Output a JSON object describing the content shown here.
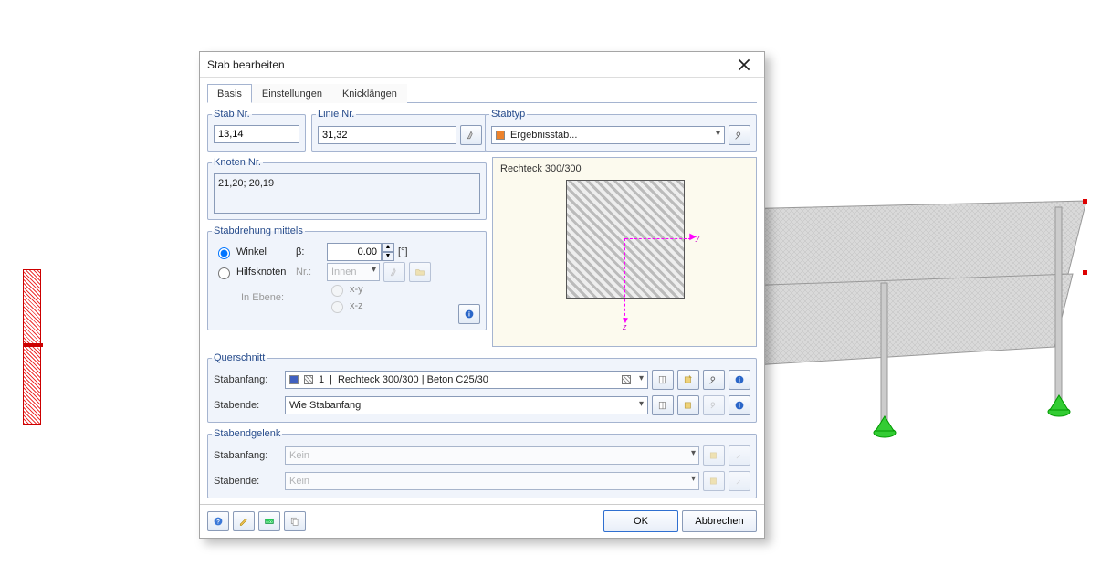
{
  "dialog": {
    "title": "Stab bearbeiten",
    "tabs": [
      "Basis",
      "Einstellungen",
      "Knicklängen"
    ],
    "active_tab": 0
  },
  "stab_nr": {
    "label": "Stab Nr.",
    "value": "13,14"
  },
  "linie_nr": {
    "label": "Linie Nr.",
    "value": "31,32"
  },
  "stabtyp": {
    "label": "Stabtyp",
    "value": "Ergebnisstab..."
  },
  "knoten_nr": {
    "label": "Knoten Nr.",
    "value": "21,20; 20,19"
  },
  "rotation": {
    "label": "Stabdrehung mittels",
    "winkel_label": "Winkel",
    "beta": "β:",
    "beta_value": "0.00",
    "beta_unit": "[°]",
    "hilfsknoten_label": "Hilfsknoten",
    "nr_label": "Nr.:",
    "nr_value": "Innen",
    "in_ebene_label": "In Ebene:",
    "plane_xy": "x-y",
    "plane_xz": "x-z"
  },
  "preview": {
    "title": "Rechteck 300/300",
    "axis_y": "y",
    "axis_z": "z"
  },
  "querschnitt": {
    "label": "Querschnitt",
    "anfang_label": "Stabanfang:",
    "anfang_num": "1",
    "anfang_text": "Rechteck 300/300 | Beton C25/30",
    "ende_label": "Stabende:",
    "ende_text": "Wie Stabanfang"
  },
  "gelenk": {
    "label": "Stabendgelenk",
    "anfang_label": "Stabanfang:",
    "anfang_value": "Kein",
    "ende_label": "Stabende:",
    "ende_value": "Kein"
  },
  "footer": {
    "ok": "OK",
    "cancel": "Abbrechen"
  }
}
